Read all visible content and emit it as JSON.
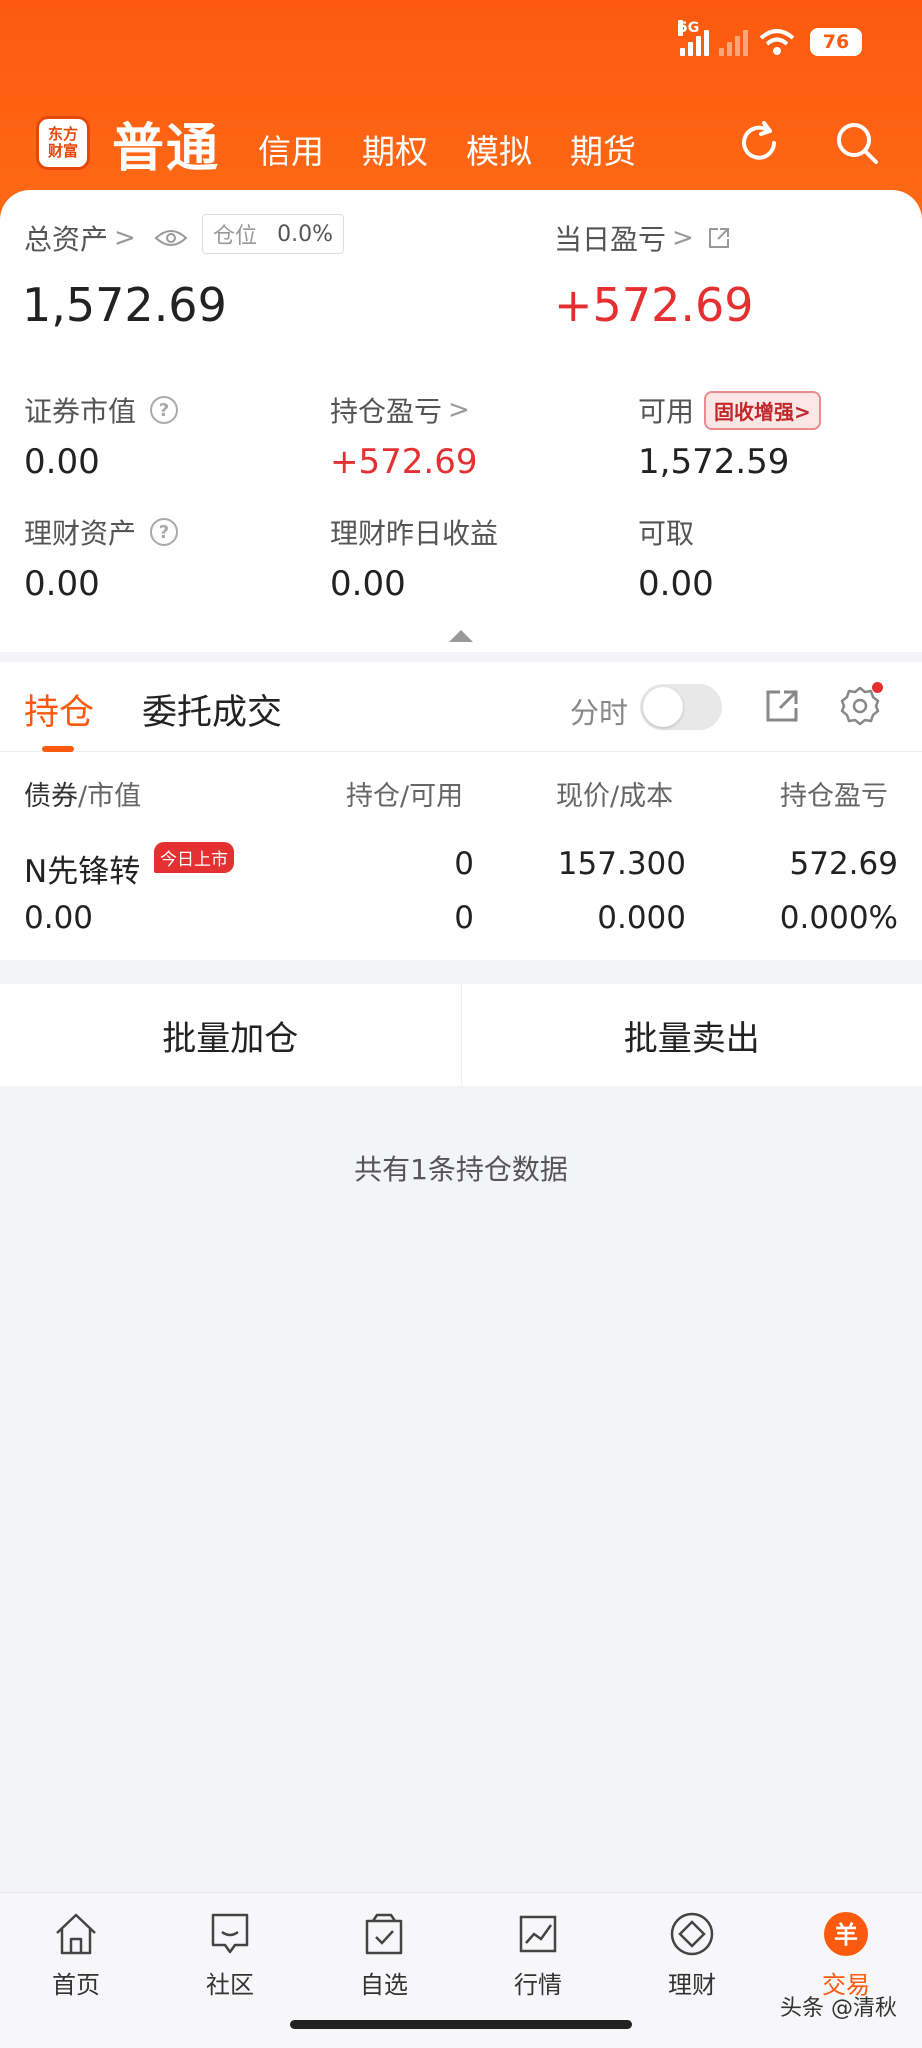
{
  "status_bar": {
    "network": "5G",
    "battery": "76"
  },
  "header": {
    "logo_line1": "东方",
    "logo_line2": "财富",
    "tabs": [
      "普通",
      "信用",
      "期权",
      "模拟",
      "期货"
    ]
  },
  "summary": {
    "total_assets_label": "总资产",
    "total_assets_value": "1,572.69",
    "position_label": "仓位",
    "position_value": "0.0%",
    "daily_pnl_label": "当日盈亏",
    "daily_pnl_value": "+572.69",
    "securities_value_label": "证券市值",
    "securities_value": "0.00",
    "holding_pnl_label": "持仓盈亏",
    "holding_pnl_value": "+572.69",
    "available_label": "可用",
    "available_badge": "固收增强>",
    "available_value": "1,572.59",
    "wealth_assets_label": "理财资产",
    "wealth_assets_value": "0.00",
    "wealth_yesterday_label": "理财昨日收益",
    "wealth_yesterday_value": "0.00",
    "withdrawable_label": "可取",
    "withdrawable_value": "0.00"
  },
  "holdings": {
    "tab_active": "持仓",
    "tab_inactive": "委托成交",
    "fenshi_label": "分时",
    "columns": {
      "name_primary": "债券",
      "name_secondary": "/市值",
      "qty": "持仓/可用",
      "price": "现价/成本",
      "pnl": "持仓盈亏"
    },
    "rows": [
      {
        "name": "N先锋转",
        "badge": "今日上市",
        "market_value": "0.00",
        "holding": "0",
        "available": "0",
        "price": "157.300",
        "cost": "0.000",
        "pnl": "572.69",
        "pnl_pct": "0.000%"
      }
    ]
  },
  "actions": {
    "batch_add": "批量加仓",
    "batch_sell": "批量卖出"
  },
  "footer_note": "共有1条持仓数据",
  "tabbar": {
    "items": [
      "首页",
      "社区",
      "自选",
      "行情",
      "理财",
      "交易"
    ],
    "active_icon_glyph": "羊"
  },
  "watermark": "头条 @清秋",
  "colors": {
    "brand": "#fb5a0f",
    "gain": "#e53032"
  }
}
